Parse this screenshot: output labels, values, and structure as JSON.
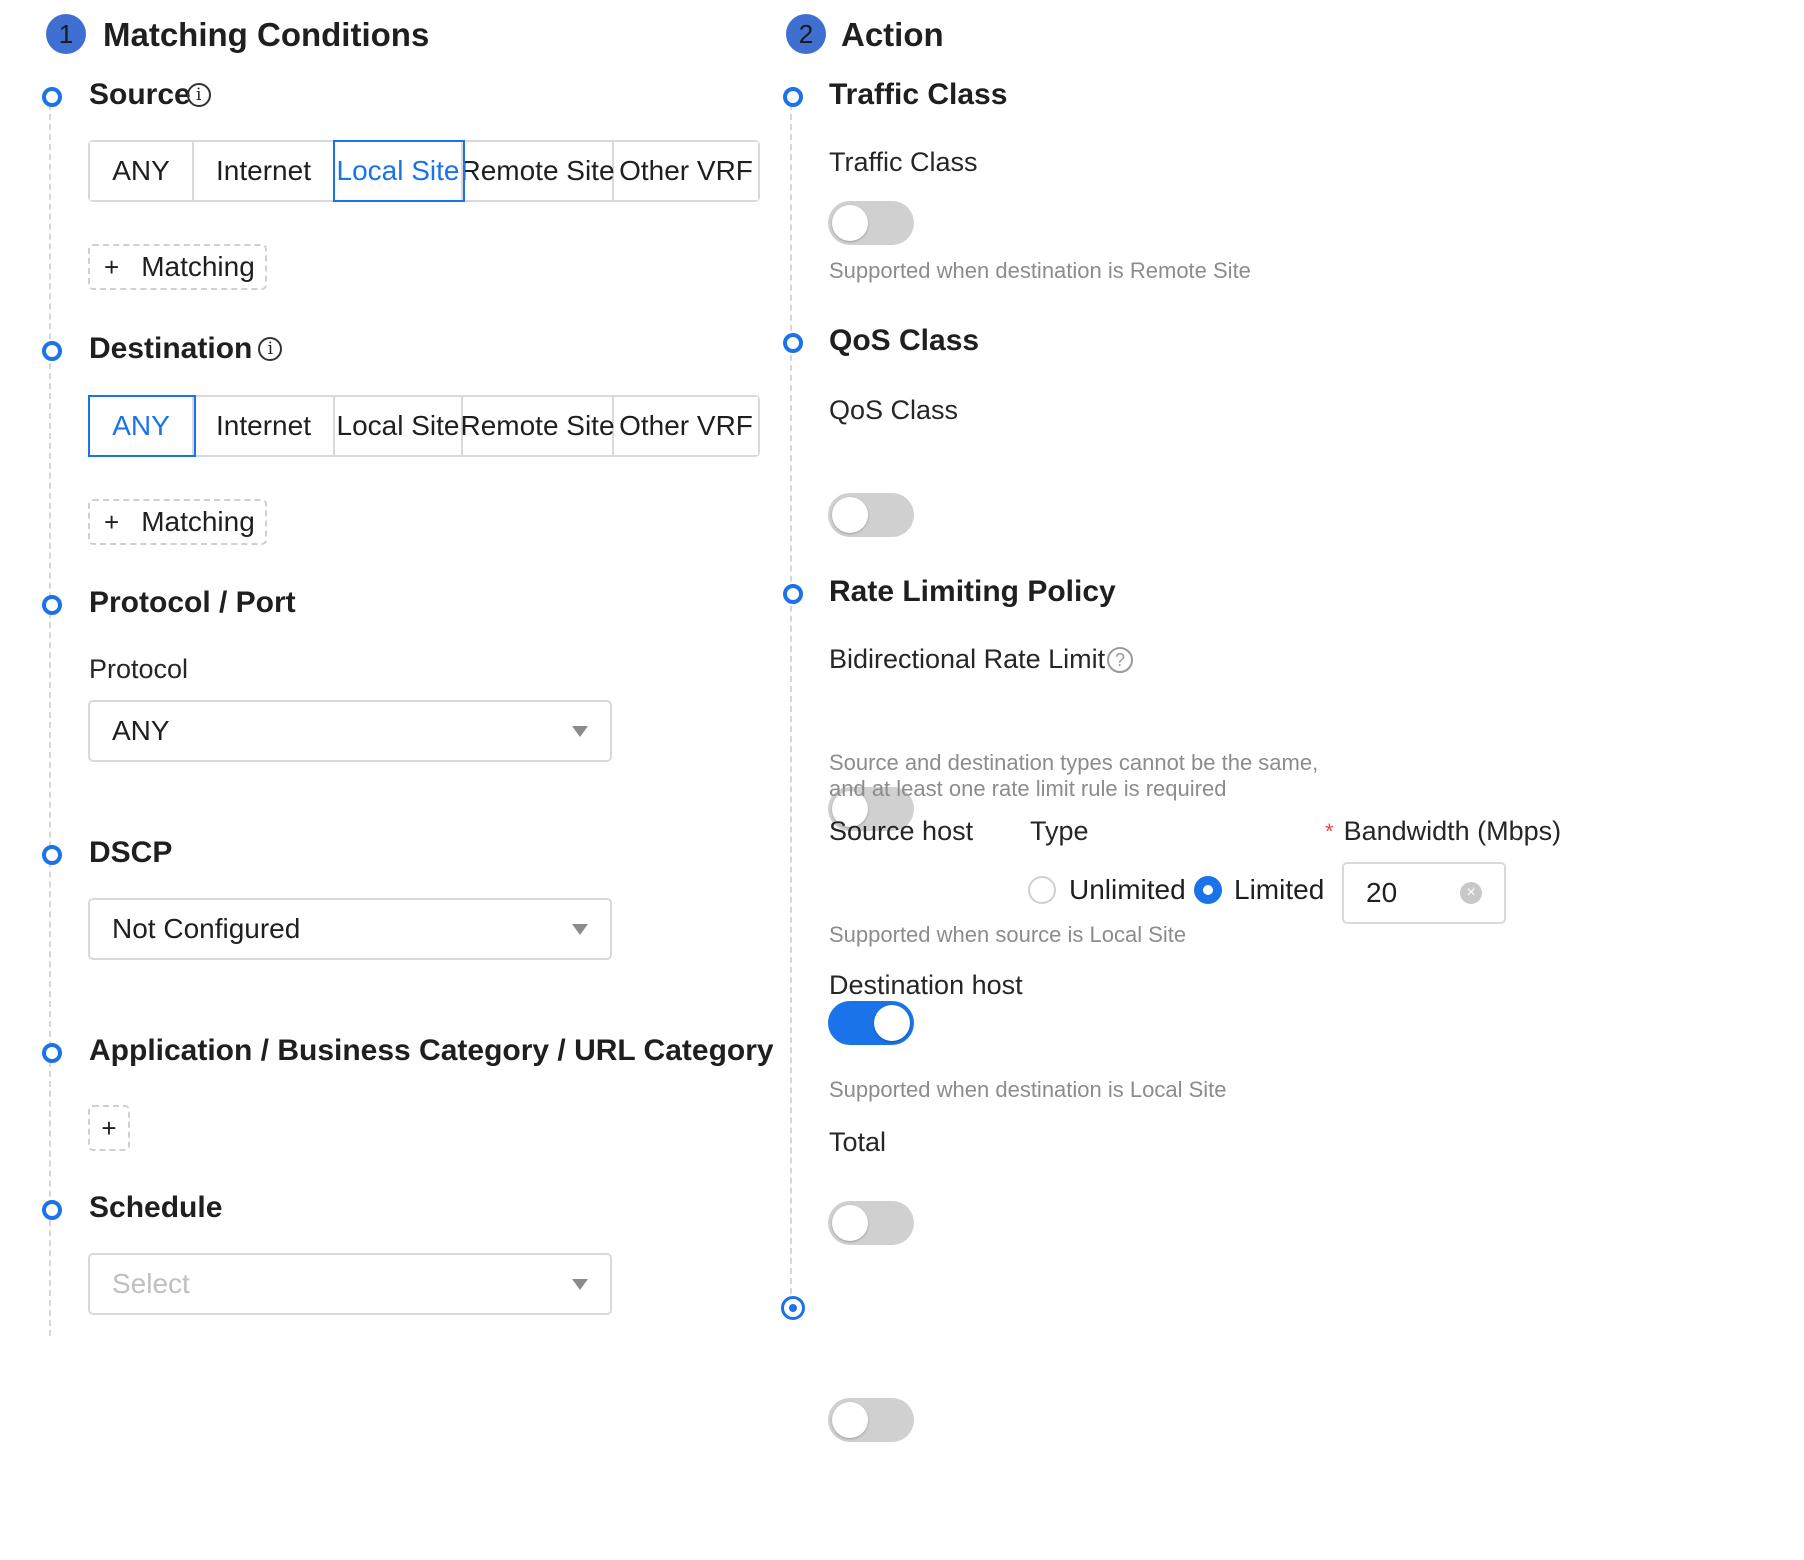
{
  "steps": [
    {
      "number": "1",
      "title": "Matching Conditions"
    },
    {
      "number": "2",
      "title": "Action"
    }
  ],
  "matching": {
    "source": {
      "title": "Source",
      "options": [
        "ANY",
        "Internet",
        "Local Site",
        "Remote Site",
        "Other VRF"
      ],
      "selected": "Local Site",
      "add_label": "Matching",
      "add_plus": "+"
    },
    "destination": {
      "title": "Destination",
      "options": [
        "ANY",
        "Internet",
        "Local Site",
        "Remote Site",
        "Other VRF"
      ],
      "selected": "ANY",
      "add_label": "Matching",
      "add_plus": "+"
    },
    "protocol_port": {
      "title": "Protocol / Port",
      "protocol_label": "Protocol",
      "protocol_value": "ANY"
    },
    "dscp": {
      "title": "DSCP",
      "value": "Not Configured"
    },
    "application": {
      "title": "Application / Business Category / URL Category",
      "add_plus": "+"
    },
    "schedule": {
      "title": "Schedule",
      "placeholder": "Select"
    }
  },
  "action": {
    "traffic_class": {
      "title": "Traffic Class",
      "label": "Traffic Class",
      "enabled": false,
      "hint": "Supported when destination is Remote Site"
    },
    "qos_class": {
      "title": "QoS Class",
      "label": "QoS Class",
      "enabled": false
    },
    "rate_limiting": {
      "title": "Rate Limiting Policy",
      "bidirectional_label": "Bidirectional Rate Limit",
      "help_icon": "?",
      "bidirectional_enabled": false,
      "hint_line1": "Source and destination types cannot be the same,",
      "hint_line2": "and at least one rate limit rule is required",
      "source_host_label": "Source host",
      "type_label": "Type",
      "required_mark": "*",
      "bandwidth_label": "Bandwidth (Mbps)",
      "source_host_enabled": true,
      "type_options": [
        "Unlimited",
        "Limited"
      ],
      "type_selected": "Limited",
      "bandwidth_value": "20",
      "clear_icon": "×",
      "source_hint": "Supported when source is Local Site",
      "destination_host_label": "Destination host",
      "destination_host_enabled": false,
      "destination_hint": "Supported when destination is Local Site",
      "total_label": "Total",
      "total_enabled": false
    }
  },
  "colors": {
    "accent": "#1a73e8",
    "step_badge": "#3f6fd1",
    "hint": "#8c8c8c",
    "border": "#d9d9d9"
  },
  "icons": {
    "info": "i",
    "caret": "caret-down-icon"
  }
}
